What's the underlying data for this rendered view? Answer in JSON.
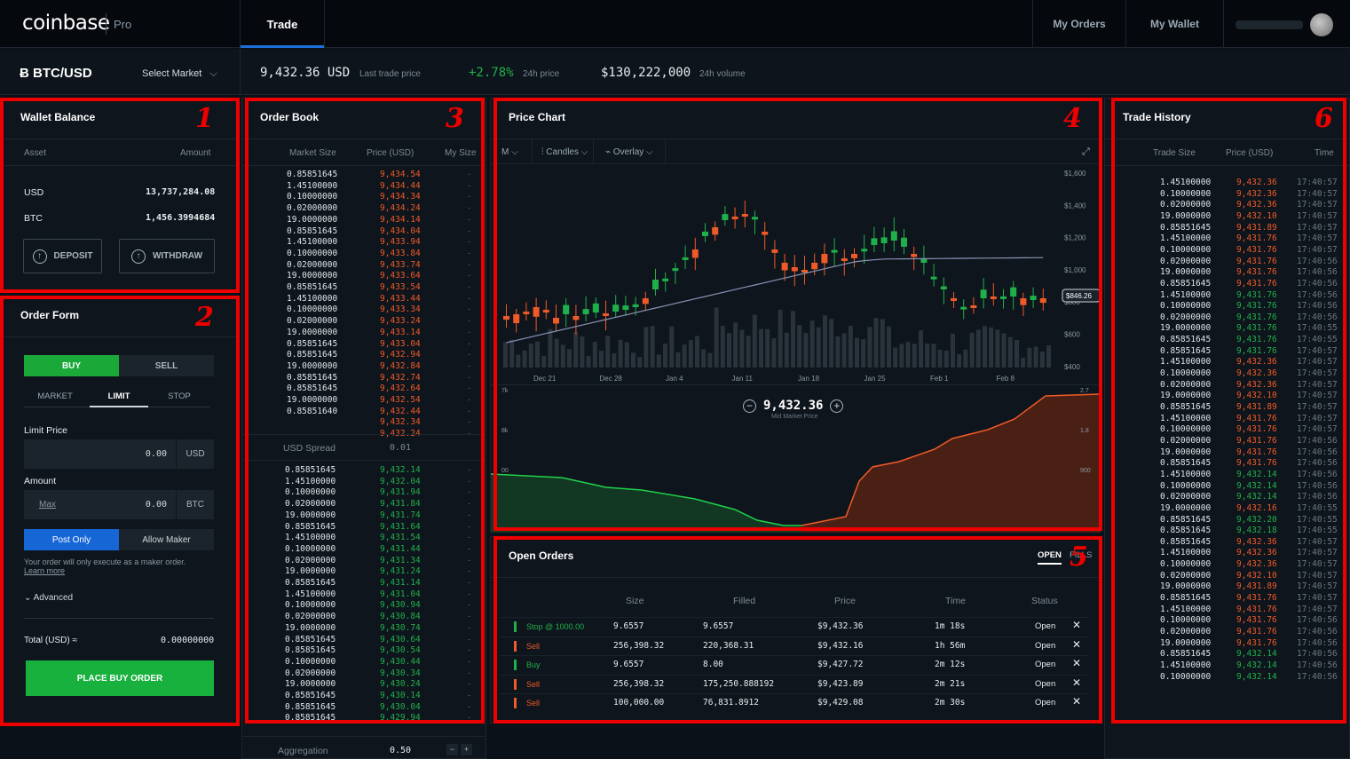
{
  "nav": {
    "logo": "coinbase",
    "pro": "Pro",
    "tab": "Trade",
    "my_orders": "My Orders",
    "my_wallet": "My Wallet"
  },
  "market": {
    "pair": "BTC/USD",
    "select": "Select Market",
    "last_price": "9,432.36",
    "last_unit": "USD",
    "last_label": "Last trade price",
    "change": "+2.78%",
    "change_label": "24h price",
    "volume": "$130,222,000",
    "volume_label": "24h volume"
  },
  "wallet": {
    "title": "Wallet Balance",
    "col_asset": "Asset",
    "col_amount": "Amount",
    "rows": [
      {
        "asset": "USD",
        "amount": "13,737,284.08"
      },
      {
        "asset": "BTC",
        "amount": "1,456.3994684"
      }
    ],
    "deposit": "DEPOSIT",
    "withdraw": "WITHDRAW"
  },
  "order_form": {
    "title": "Order Form",
    "buy": "BUY",
    "sell": "SELL",
    "tabs": [
      "MARKET",
      "LIMIT",
      "STOP"
    ],
    "limit_label": "Limit Price",
    "limit_value": "0.00",
    "limit_unit": "USD",
    "amount_label": "Amount",
    "amount_max": "Max",
    "amount_value": "0.00",
    "amount_unit": "BTC",
    "post_only": "Post Only",
    "allow_maker": "Allow Maker",
    "note": "Your order will only execute as a maker order.",
    "learn": "Learn more",
    "advanced": "Advanced",
    "total_label": "Total (USD) ≈",
    "total_value": "0.00000000",
    "place": "PLACE BUY ORDER"
  },
  "order_book": {
    "title": "Order Book",
    "col_size": "Market Size",
    "col_price": "Price (USD)",
    "col_my": "My Size",
    "asks": [
      [
        "0.85851645",
        "9,434.54"
      ],
      [
        "1.45100000",
        "9,434.44"
      ],
      [
        "0.10000000",
        "9,434.34"
      ],
      [
        "0.02000000",
        "9,434.24"
      ],
      [
        "19.0000000",
        "9,434.14"
      ],
      [
        "0.85851645",
        "9,434.04"
      ],
      [
        "1.45100000",
        "9,433.94"
      ],
      [
        "0.10000000",
        "9,433.84"
      ],
      [
        "0.02000000",
        "9,433.74"
      ],
      [
        "19.0000000",
        "9,433.64"
      ],
      [
        "0.85851645",
        "9,433.54"
      ],
      [
        "1.45100000",
        "9,433.44"
      ],
      [
        "0.10000000",
        "9,433.34"
      ],
      [
        "0.02000000",
        "9,433.24"
      ],
      [
        "19.0000000",
        "9,433.14"
      ],
      [
        "0.85851645",
        "9,433.04"
      ],
      [
        "0.85851645",
        "9,432.94"
      ],
      [
        "19.0000000",
        "9,432.84"
      ],
      [
        "0.85851645",
        "9,432.74"
      ],
      [
        "0.85851645",
        "9,432.64"
      ],
      [
        "19.0000000",
        "9,432.54"
      ],
      [
        "0.85851640",
        "9,432.44"
      ],
      [
        "",
        "9,432.34"
      ],
      [
        "",
        "9,432.24"
      ]
    ],
    "spread_label": "USD Spread",
    "spread_value": "0.01",
    "bids": [
      [
        "0.85851645",
        "9,432.14"
      ],
      [
        "1.45100000",
        "9,432.04"
      ],
      [
        "0.10000000",
        "9,431.94"
      ],
      [
        "0.02000000",
        "9,431.84"
      ],
      [
        "19.0000000",
        "9,431.74"
      ],
      [
        "0.85851645",
        "9,431.64"
      ],
      [
        "1.45100000",
        "9,431.54"
      ],
      [
        "0.10000000",
        "9,431.44"
      ],
      [
        "0.02000000",
        "9,431.34"
      ],
      [
        "19.0000000",
        "9,431.24"
      ],
      [
        "0.85851645",
        "9,431.14"
      ],
      [
        "1.45100000",
        "9,431.04"
      ],
      [
        "0.10000000",
        "9,430.94"
      ],
      [
        "0.02000000",
        "9,430.84"
      ],
      [
        "19.0000000",
        "9,430.74"
      ],
      [
        "0.85851645",
        "9,430.64"
      ],
      [
        "0.85851645",
        "9,430.54"
      ],
      [
        "0.10000000",
        "9,430.44"
      ],
      [
        "0.02000000",
        "9,430.34"
      ],
      [
        "19.0000000",
        "9,430.24"
      ],
      [
        "0.85851645",
        "9,430.14"
      ],
      [
        "0.85851645",
        "9,430.04"
      ],
      [
        "0.85851645",
        "9,429.94"
      ]
    ],
    "aggregation_label": "Aggregation",
    "aggregation_value": "0.50"
  },
  "price_chart": {
    "title": "Price Chart",
    "granularity": "M",
    "candles": "Candles",
    "overlay": "Overlay",
    "x_labels": [
      "Dec 21",
      "Dec 28",
      "Jan 4",
      "Jan 11",
      "Jan 18",
      "Jan 25",
      "Feb 1",
      "Feb 8"
    ],
    "y_labels": [
      "$1,600",
      "$1,400",
      "$1,200",
      "$1,000",
      "$800",
      "$600",
      "$400"
    ],
    "current_tag": "$846.26",
    "mid_price": "9,432.36",
    "mid_label": "Mid Market Price",
    "depth_left_labels": [
      "7k",
      "8k",
      "00"
    ],
    "depth_right_labels": [
      "2.7",
      "1.8",
      "900"
    ]
  },
  "open_orders": {
    "title": "Open Orders",
    "tab_open": "OPEN",
    "tab_fills": "FILLS",
    "cols": [
      "Size",
      "Filled",
      "Price",
      "Time",
      "Status"
    ],
    "rows": [
      {
        "type": "Stop @ 1000.00",
        "side": "buy",
        "size": "9.6557",
        "filled": "9.6557",
        "price": "$9,432.36",
        "time": "1m 18s",
        "status": "Open"
      },
      {
        "type": "Sell",
        "side": "sell",
        "size": "256,398.32",
        "filled": "220,368.31",
        "price": "$9,432.16",
        "time": "1h 56m",
        "status": "Open"
      },
      {
        "type": "Buy",
        "side": "buy",
        "size": "9.6557",
        "filled": "8.00",
        "price": "$9,427.72",
        "time": "2m 12s",
        "status": "Open"
      },
      {
        "type": "Sell",
        "side": "sell",
        "size": "256,398.32",
        "filled": "175,250.888192",
        "price": "$9,423.89",
        "time": "2m 21s",
        "status": "Open"
      },
      {
        "type": "Sell",
        "side": "sell",
        "size": "100,000.00",
        "filled": "76,831.8912",
        "price": "$9,429.08",
        "time": "2m 30s",
        "status": "Open"
      }
    ]
  },
  "trade_history": {
    "title": "Trade History",
    "col_size": "Trade Size",
    "col_price": "Price (USD)",
    "col_time": "Time",
    "rows": [
      [
        "1.45100000",
        "9,432.36",
        "r",
        "17:40:57"
      ],
      [
        "0.10000000",
        "9,432.36",
        "r",
        "17:40:57"
      ],
      [
        "0.02000000",
        "9,432.36",
        "r",
        "17:40:57"
      ],
      [
        "19.0000000",
        "9,432.10",
        "r",
        "17:40:57"
      ],
      [
        "0.85851645",
        "9,431.89",
        "r",
        "17:40:57"
      ],
      [
        "1.45100000",
        "9,431.76",
        "r",
        "17:40:57"
      ],
      [
        "0.10000000",
        "9,431.76",
        "r",
        "17:40:57"
      ],
      [
        "0.02000000",
        "9,431.76",
        "r",
        "17:40:56"
      ],
      [
        "19.0000000",
        "9,431.76",
        "r",
        "17:40:56"
      ],
      [
        "0.85851645",
        "9,431.76",
        "r",
        "17:40:56"
      ],
      [
        "1.45100000",
        "9,431.76",
        "g",
        "17:40:56"
      ],
      [
        "0.10000000",
        "9,431.76",
        "g",
        "17:40:56"
      ],
      [
        "0.02000000",
        "9,431.76",
        "g",
        "17:40:56"
      ],
      [
        "19.0000000",
        "9,431.76",
        "g",
        "17:40:55"
      ],
      [
        "0.85851645",
        "9,431.76",
        "g",
        "17:40:55"
      ],
      [
        "0.85851645",
        "9,431.76",
        "g",
        "17:40:57"
      ],
      [
        "1.45100000",
        "9,432.36",
        "r",
        "17:40:57"
      ],
      [
        "0.10000000",
        "9,432.36",
        "r",
        "17:40:57"
      ],
      [
        "0.02000000",
        "9,432.36",
        "r",
        "17:40:57"
      ],
      [
        "19.0000000",
        "9,432.10",
        "r",
        "17:40:57"
      ],
      [
        "0.85851645",
        "9,431.89",
        "r",
        "17:40:57"
      ],
      [
        "1.45100000",
        "9,431.76",
        "r",
        "17:40:57"
      ],
      [
        "0.10000000",
        "9,431.76",
        "r",
        "17:40:57"
      ],
      [
        "0.02000000",
        "9,431.76",
        "r",
        "17:40:56"
      ],
      [
        "19.0000000",
        "9,431.76",
        "r",
        "17:40:56"
      ],
      [
        "0.85851645",
        "9,431.76",
        "r",
        "17:40:56"
      ],
      [
        "1.45100000",
        "9,432.14",
        "g",
        "17:40:56"
      ],
      [
        "0.10000000",
        "9,432.14",
        "g",
        "17:40:56"
      ],
      [
        "0.02000000",
        "9,432.14",
        "g",
        "17:40:56"
      ],
      [
        "19.0000000",
        "9,432.16",
        "r",
        "17:40:55"
      ],
      [
        "0.85851645",
        "9,432.20",
        "g",
        "17:40:55"
      ],
      [
        "0.85851645",
        "9,432.18",
        "g",
        "17:40:55"
      ],
      [
        "0.85851645",
        "9,432.36",
        "r",
        "17:40:57"
      ],
      [
        "1.45100000",
        "9,432.36",
        "r",
        "17:40:57"
      ],
      [
        "0.10000000",
        "9,432.36",
        "r",
        "17:40:57"
      ],
      [
        "0.02000000",
        "9,432.10",
        "r",
        "17:40:57"
      ],
      [
        "19.0000000",
        "9,431.89",
        "r",
        "17:40:57"
      ],
      [
        "0.85851645",
        "9,431.76",
        "r",
        "17:40:57"
      ],
      [
        "1.45100000",
        "9,431.76",
        "r",
        "17:40:57"
      ],
      [
        "0.10000000",
        "9,431.76",
        "r",
        "17:40:56"
      ],
      [
        "0.02000000",
        "9,431.76",
        "r",
        "17:40:56"
      ],
      [
        "19.0000000",
        "9,431.76",
        "r",
        "17:40:56"
      ],
      [
        "0.85851645",
        "9,432.14",
        "g",
        "17:40:56"
      ],
      [
        "1.45100000",
        "9,432.14",
        "g",
        "17:40:56"
      ],
      [
        "0.10000000",
        "9,432.14",
        "g",
        "17:40:56"
      ]
    ]
  },
  "annotations": [
    "1",
    "2",
    "3",
    "4",
    "5",
    "6"
  ],
  "colors": {
    "highlight": "#ee0000",
    "buy": "#20b04b",
    "sell": "#f05a28",
    "accent": "#1e6fd9"
  }
}
